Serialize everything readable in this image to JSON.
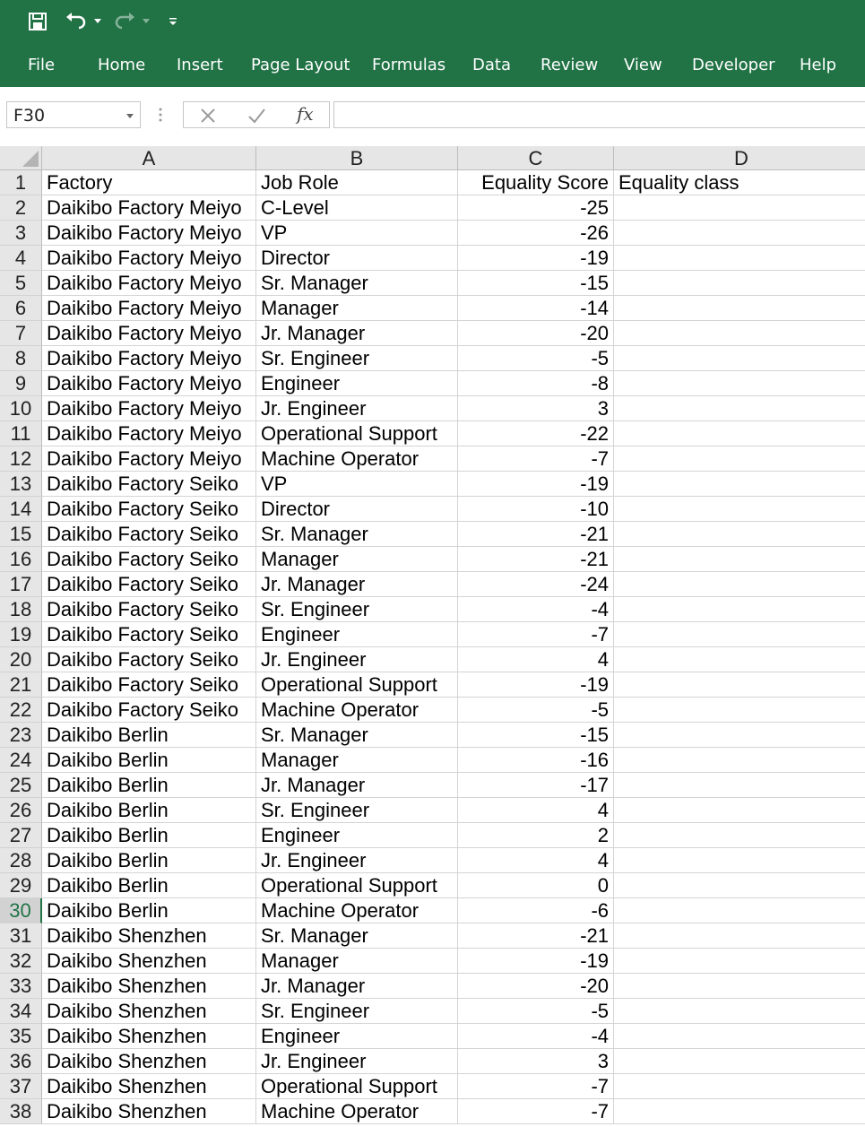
{
  "quick_access": {
    "icons": [
      "save-icon",
      "undo-icon",
      "redo-icon",
      "customize-icon"
    ]
  },
  "ribbon": {
    "tabs": [
      "File",
      "Home",
      "Insert",
      "Page Layout",
      "Formulas",
      "Data",
      "Review",
      "View",
      "Developer",
      "Help"
    ]
  },
  "formula_bar": {
    "name_box": "F30",
    "fx_label": "fx",
    "formula": ""
  },
  "sheet": {
    "columns": [
      "A",
      "B",
      "C",
      "D"
    ],
    "selected_row": 30,
    "rows": [
      {
        "n": "1",
        "a": "Factory",
        "b": "Job Role",
        "c": "Equality Score",
        "d": "Equality class"
      },
      {
        "n": "2",
        "a": "Daikibo Factory Meiyo",
        "b": "C-Level",
        "c": "-25",
        "d": ""
      },
      {
        "n": "3",
        "a": "Daikibo Factory Meiyo",
        "b": "VP",
        "c": "-26",
        "d": ""
      },
      {
        "n": "4",
        "a": "Daikibo Factory Meiyo",
        "b": "Director",
        "c": "-19",
        "d": ""
      },
      {
        "n": "5",
        "a": "Daikibo Factory Meiyo",
        "b": "Sr. Manager",
        "c": "-15",
        "d": ""
      },
      {
        "n": "6",
        "a": "Daikibo Factory Meiyo",
        "b": "Manager",
        "c": "-14",
        "d": ""
      },
      {
        "n": "7",
        "a": "Daikibo Factory Meiyo",
        "b": "Jr. Manager",
        "c": "-20",
        "d": ""
      },
      {
        "n": "8",
        "a": "Daikibo Factory Meiyo",
        "b": "Sr. Engineer",
        "c": "-5",
        "d": ""
      },
      {
        "n": "9",
        "a": "Daikibo Factory Meiyo",
        "b": "Engineer",
        "c": "-8",
        "d": ""
      },
      {
        "n": "10",
        "a": "Daikibo Factory Meiyo",
        "b": "Jr. Engineer",
        "c": "3",
        "d": ""
      },
      {
        "n": "11",
        "a": "Daikibo Factory Meiyo",
        "b": "Operational Support",
        "c": "-22",
        "d": ""
      },
      {
        "n": "12",
        "a": "Daikibo Factory Meiyo",
        "b": "Machine Operator",
        "c": "-7",
        "d": ""
      },
      {
        "n": "13",
        "a": "Daikibo Factory Seiko",
        "b": "VP",
        "c": "-19",
        "d": ""
      },
      {
        "n": "14",
        "a": "Daikibo Factory Seiko",
        "b": "Director",
        "c": "-10",
        "d": ""
      },
      {
        "n": "15",
        "a": "Daikibo Factory Seiko",
        "b": "Sr. Manager",
        "c": "-21",
        "d": ""
      },
      {
        "n": "16",
        "a": "Daikibo Factory Seiko",
        "b": "Manager",
        "c": "-21",
        "d": ""
      },
      {
        "n": "17",
        "a": "Daikibo Factory Seiko",
        "b": "Jr. Manager",
        "c": "-24",
        "d": ""
      },
      {
        "n": "18",
        "a": "Daikibo Factory Seiko",
        "b": "Sr. Engineer",
        "c": "-4",
        "d": ""
      },
      {
        "n": "19",
        "a": "Daikibo Factory Seiko",
        "b": "Engineer",
        "c": "-7",
        "d": ""
      },
      {
        "n": "20",
        "a": "Daikibo Factory Seiko",
        "b": "Jr. Engineer",
        "c": "4",
        "d": ""
      },
      {
        "n": "21",
        "a": "Daikibo Factory Seiko",
        "b": "Operational Support",
        "c": "-19",
        "d": ""
      },
      {
        "n": "22",
        "a": "Daikibo Factory Seiko",
        "b": "Machine Operator",
        "c": "-5",
        "d": ""
      },
      {
        "n": "23",
        "a": "Daikibo Berlin",
        "b": "Sr. Manager",
        "c": "-15",
        "d": ""
      },
      {
        "n": "24",
        "a": "Daikibo Berlin",
        "b": "Manager",
        "c": "-16",
        "d": ""
      },
      {
        "n": "25",
        "a": "Daikibo Berlin",
        "b": "Jr. Manager",
        "c": "-17",
        "d": ""
      },
      {
        "n": "26",
        "a": "Daikibo Berlin",
        "b": "Sr. Engineer",
        "c": "4",
        "d": ""
      },
      {
        "n": "27",
        "a": "Daikibo Berlin",
        "b": "Engineer",
        "c": "2",
        "d": ""
      },
      {
        "n": "28",
        "a": "Daikibo Berlin",
        "b": "Jr. Engineer",
        "c": "4",
        "d": ""
      },
      {
        "n": "29",
        "a": "Daikibo Berlin",
        "b": "Operational Support",
        "c": "0",
        "d": ""
      },
      {
        "n": "30",
        "a": "Daikibo Berlin",
        "b": "Machine Operator",
        "c": "-6",
        "d": ""
      },
      {
        "n": "31",
        "a": "Daikibo Shenzhen",
        "b": "Sr. Manager",
        "c": "-21",
        "d": ""
      },
      {
        "n": "32",
        "a": "Daikibo Shenzhen",
        "b": "Manager",
        "c": "-19",
        "d": ""
      },
      {
        "n": "33",
        "a": "Daikibo Shenzhen",
        "b": "Jr. Manager",
        "c": "-20",
        "d": ""
      },
      {
        "n": "34",
        "a": "Daikibo Shenzhen",
        "b": "Sr. Engineer",
        "c": "-5",
        "d": ""
      },
      {
        "n": "35",
        "a": "Daikibo Shenzhen",
        "b": "Engineer",
        "c": "-4",
        "d": ""
      },
      {
        "n": "36",
        "a": "Daikibo Shenzhen",
        "b": "Jr. Engineer",
        "c": "3",
        "d": ""
      },
      {
        "n": "37",
        "a": "Daikibo Shenzhen",
        "b": "Operational Support",
        "c": "-7",
        "d": ""
      },
      {
        "n": "38",
        "a": "Daikibo Shenzhen",
        "b": "Machine Operator",
        "c": "-7",
        "d": ""
      }
    ]
  },
  "colors": {
    "ribbon": "#217346",
    "header_bg": "#e6e6e6",
    "selected_row_text": "#217346"
  }
}
